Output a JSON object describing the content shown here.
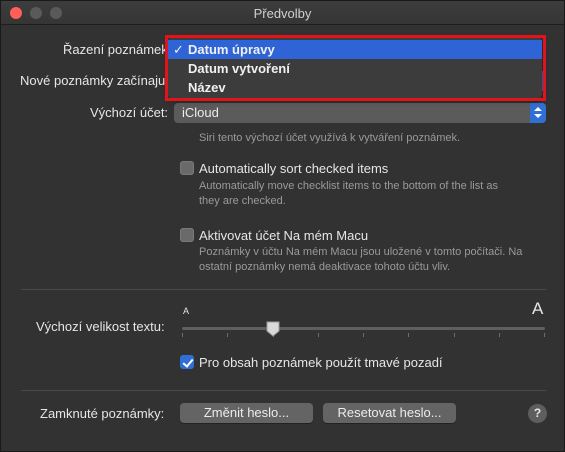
{
  "window": {
    "title": "Předvolby"
  },
  "sort": {
    "label": "Řazení poznámek",
    "options": [
      "Datum úpravy",
      "Datum vytvoření",
      "Název"
    ],
    "selected_check": "✓"
  },
  "new_notes": {
    "label": "Nové poznámky začínaju"
  },
  "default_account": {
    "label": "Výchozí účet:",
    "value": "iCloud",
    "hint": "Siri tento výchozí účet využívá k vytváření poznámek."
  },
  "auto_sort": {
    "label": "Automatically sort checked items",
    "hint_line1": "Automatically move checklist items to the bottom of the list as",
    "hint_line2": "they are checked.",
    "checked": false
  },
  "on_my_mac": {
    "label": "Aktivovat účet Na mém Macu",
    "hint_line1": "Poznámky v účtu Na mém Macu jsou uložené v tomto počítači. Na",
    "hint_line2": "ostatní poznámky nemá deaktivace tohoto účtu vliv.",
    "checked": false
  },
  "text_size": {
    "label": "Výchozí velikost textu:",
    "small_glyph": "A",
    "large_glyph": "A",
    "level_fraction": 0.25
  },
  "dark_bg": {
    "label": "Pro obsah poznámek použít tmavé pozadí",
    "checked": true
  },
  "locked_notes": {
    "label": "Zamknuté poznámky:",
    "change_password": "Změnit heslo...",
    "reset_password": "Resetovat heslo..."
  },
  "help": {
    "glyph": "?"
  },
  "colors": {
    "accent": "#2f6fd6",
    "annotation_red": "#e2141b"
  },
  "icons": [
    "close-icon",
    "minimize-icon",
    "zoom-icon",
    "checkmark-icon",
    "chevron-updown-icon",
    "slider-knob-icon",
    "help-icon"
  ]
}
